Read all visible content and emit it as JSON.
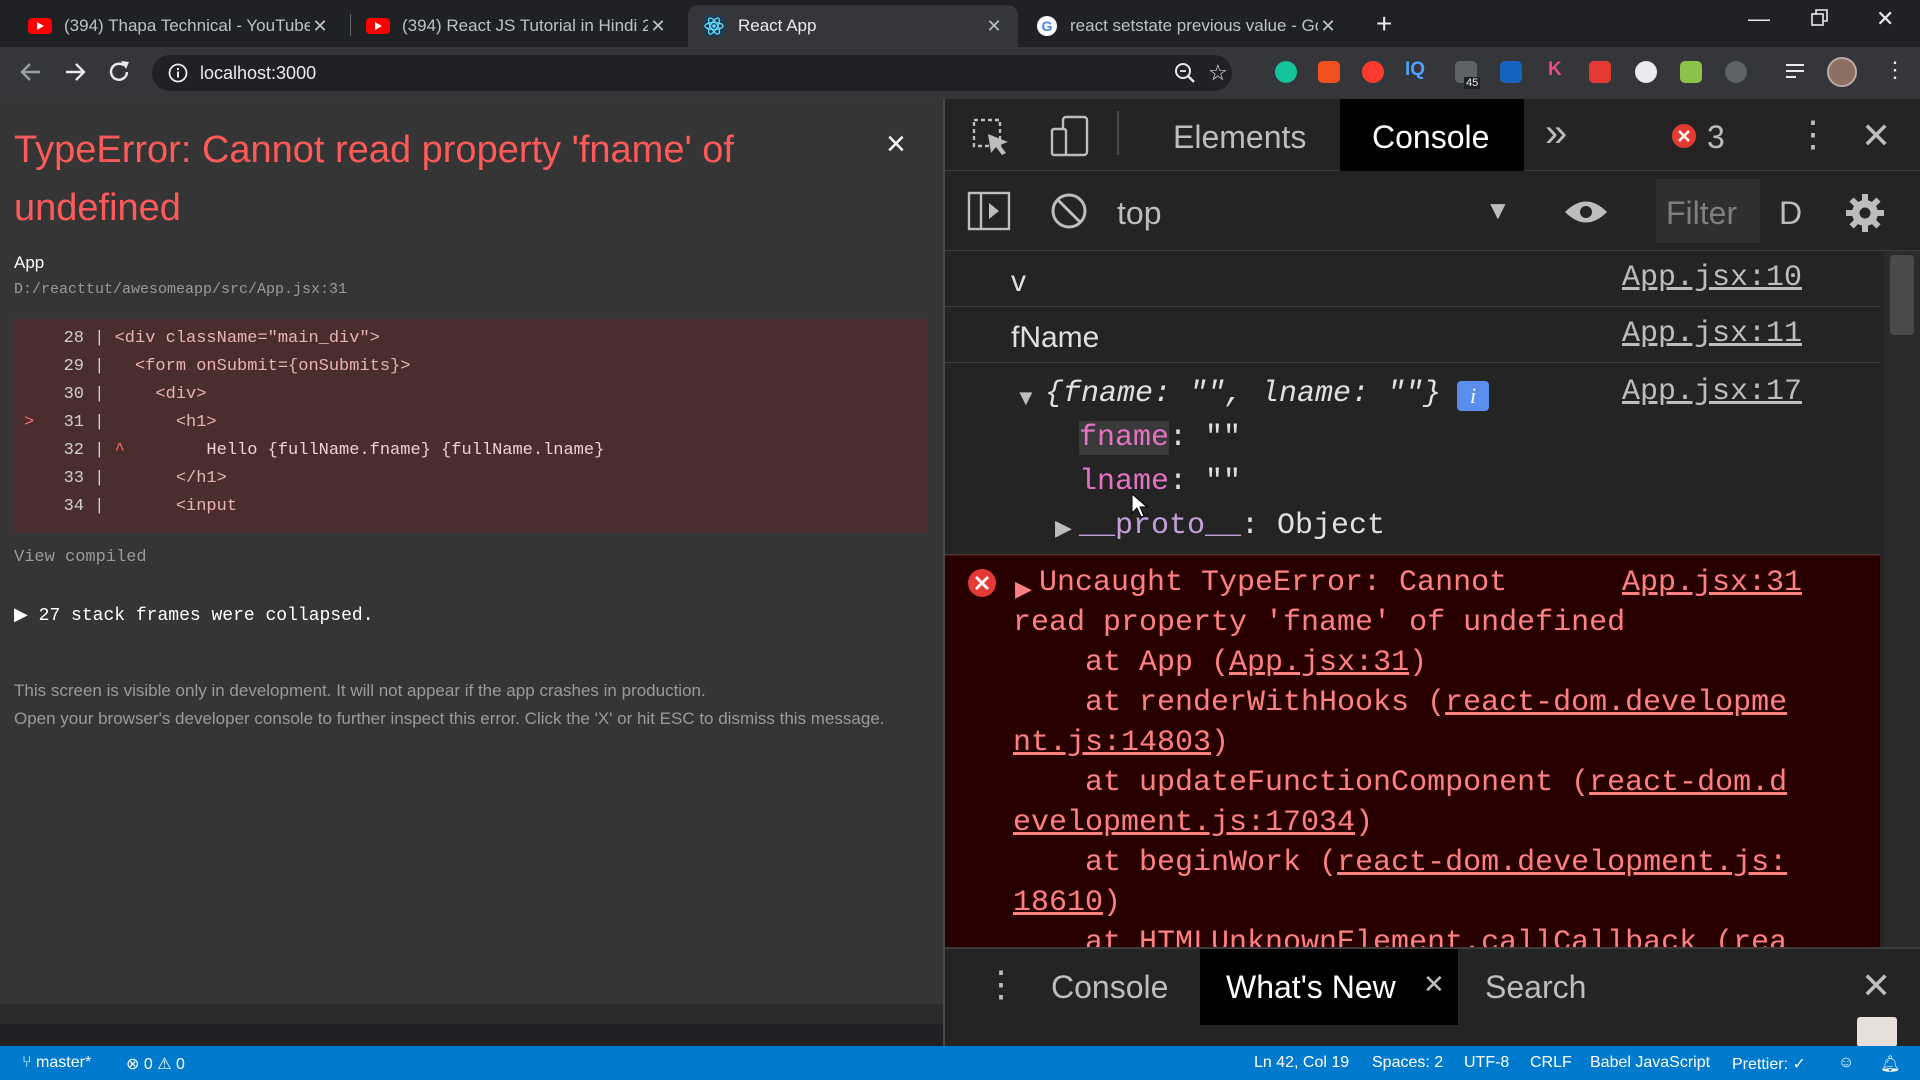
{
  "browser": {
    "tabs": [
      {
        "title": "(394) Thapa Technical - YouTube",
        "icon": "youtube-icon"
      },
      {
        "title": "(394) React JS Tutorial in Hindi 2",
        "icon": "youtube-icon"
      },
      {
        "title": "React App",
        "icon": "react-icon"
      },
      {
        "title": "react setstate previous value - Go",
        "icon": "google-icon"
      }
    ],
    "new_tab": "+",
    "url": "localhost:3000",
    "ext_badge": "45"
  },
  "overlay": {
    "title": "TypeError: Cannot read property 'fname' of undefined",
    "close": "×",
    "component": "App",
    "path": "D:/reacttut/awesomeapp/src/App.jsx:31",
    "code_lines": [
      {
        "num": "28",
        "marker": "",
        "text": "<div className=\"main_div\">"
      },
      {
        "num": "29",
        "marker": "",
        "text": "  <form onSubmit={onSubmits}>"
      },
      {
        "num": "30",
        "marker": "",
        "text": "    <div>"
      },
      {
        "num": "31",
        "marker": ">",
        "text": "      <h1>"
      },
      {
        "num": "32",
        "marker": "^",
        "text": "        Hello {fullName.fname} {fullName.lname}"
      },
      {
        "num": "33",
        "marker": "",
        "text": "      </h1>"
      },
      {
        "num": "34",
        "marker": "",
        "text": "      <input"
      }
    ],
    "view_compiled": "View compiled",
    "stack_frames": "27 stack frames were collapsed.",
    "footer_1": "This screen is visible only in development. It will not appear if the app crashes in production.",
    "footer_2": "Open your browser's developer console to further inspect this error.  Click the 'X' or hit ESC to dismiss this message."
  },
  "devtools": {
    "tab_elements": "Elements",
    "tab_console": "Console",
    "more": "»",
    "error_count": "3",
    "context": "top",
    "filter_placeholder": "Filter",
    "levels": "D",
    "logs": [
      {
        "text": "v",
        "src": "App.jsx:10"
      },
      {
        "text": "fName",
        "src": "App.jsx:11"
      }
    ],
    "object_summary": "{fname: \"\", lname: \"\"}",
    "object_src": "App.jsx:17",
    "props": [
      {
        "key": "fname",
        "value": "\"\""
      },
      {
        "key": "lname",
        "value": "\"\""
      }
    ],
    "proto_key": "__proto__",
    "proto_val": "Object",
    "error": {
      "src": "App.jsx:31",
      "line1": "Uncaught TypeError: Cannot",
      "line2": "read property 'fname' of undefined",
      "at1_pre": "    at App (",
      "at1_link": "App.jsx:31",
      "at1_post": ")",
      "at2_pre": "    at renderWithHooks (",
      "at2_link_a": "react-dom.developme",
      "at2_link_b": "nt.js:14803",
      "at2_post": ")",
      "at3_pre": "    at updateFunctionComponent (",
      "at3_link_a": "react-dom.d",
      "at3_link_b": "evelopment.js:17034",
      "at3_post": ")",
      "at4_pre": "    at beginWork (",
      "at4_link_a": "react-dom.development.js:",
      "at4_link_b": "18610",
      "at4_post": ")",
      "at5": "    at HTMLUnknownElement.callCallback (rea"
    },
    "drawer_tabs": {
      "console": "Console",
      "whats_new": "What's New",
      "search": "Search"
    }
  },
  "statusbar": {
    "branch": "master*",
    "problems": "⊗ 0 ⚠ 0",
    "position": "Ln 42, Col 19",
    "spaces": "Spaces: 2",
    "encoding": "UTF-8",
    "eol": "CRLF",
    "language": "Babel JavaScript",
    "prettier": "Prettier: ✓"
  },
  "colors": {
    "accent": "#007acc",
    "error": "#ff5a5a",
    "error_bg": "#290000"
  }
}
